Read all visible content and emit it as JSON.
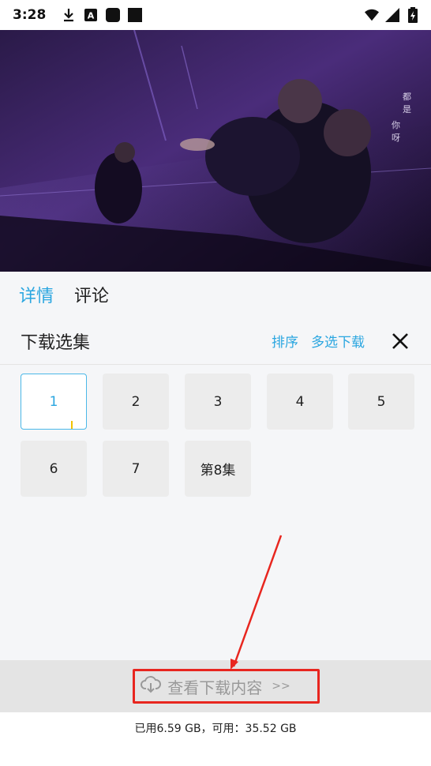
{
  "status_bar": {
    "time": "3:28",
    "left_icons": [
      "download-icon",
      "a-icon",
      "square-icon",
      "square-icon"
    ],
    "right_icons": [
      "wifi-icon",
      "signal-icon",
      "battery-icon"
    ]
  },
  "video": {
    "overlay_text": [
      "都",
      "是",
      "你",
      "呀"
    ],
    "dominant_color": "#3a2260"
  },
  "tabs": [
    {
      "label": "详情",
      "active": true
    },
    {
      "label": "评论",
      "active": false
    }
  ],
  "sheet": {
    "title": "下载选集",
    "sort_label": "排序",
    "multi_download_label": "多选下载",
    "close_icon": "close-icon"
  },
  "episodes": [
    {
      "label": "1",
      "selected": true
    },
    {
      "label": "2",
      "selected": false
    },
    {
      "label": "3",
      "selected": false
    },
    {
      "label": "4",
      "selected": false
    },
    {
      "label": "5",
      "selected": false
    },
    {
      "label": "6",
      "selected": false
    },
    {
      "label": "7",
      "selected": false
    },
    {
      "label": "第8集",
      "selected": false
    }
  ],
  "download_bar": {
    "icon": "cloud-download-icon",
    "label": "查看下载内容",
    "arrow": ">>"
  },
  "storage_text": "已用6.59 GB，可用：35.52 GB",
  "colors": {
    "accent": "#2aa6e0",
    "annotation": "#e8261f"
  }
}
